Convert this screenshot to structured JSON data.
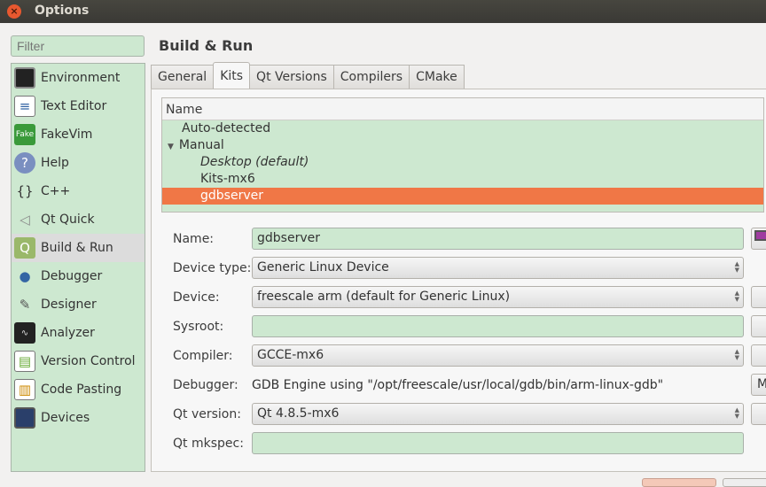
{
  "window": {
    "title": "Options",
    "close_icon": "close-icon"
  },
  "filter": {
    "placeholder": "Filter"
  },
  "sidebar": {
    "items": [
      {
        "label": "Environment",
        "icon": "monitor-icon"
      },
      {
        "label": "Text Editor",
        "icon": "text-editor-icon"
      },
      {
        "label": "FakeVim",
        "icon": "fakevim-icon"
      },
      {
        "label": "Help",
        "icon": "help-icon"
      },
      {
        "label": "C++",
        "icon": "braces-icon"
      },
      {
        "label": "Qt Quick",
        "icon": "qt-quick-icon"
      },
      {
        "label": "Build & Run",
        "icon": "build-run-icon",
        "selected": true
      },
      {
        "label": "Debugger",
        "icon": "debugger-icon"
      },
      {
        "label": "Designer",
        "icon": "designer-icon"
      },
      {
        "label": "Analyzer",
        "icon": "analyzer-icon"
      },
      {
        "label": "Version Control",
        "icon": "version-control-icon"
      },
      {
        "label": "Code Pasting",
        "icon": "code-pasting-icon"
      },
      {
        "label": "Devices",
        "icon": "devices-icon"
      }
    ]
  },
  "page": {
    "title": "Build & Run"
  },
  "tabs": [
    {
      "label": "General"
    },
    {
      "label": "Kits",
      "active": true
    },
    {
      "label": "Qt Versions"
    },
    {
      "label": "Compilers"
    },
    {
      "label": "CMake"
    }
  ],
  "tree": {
    "header": "Name",
    "rows": [
      {
        "label": "Auto-detected"
      },
      {
        "label": "Manual",
        "expanded": true
      },
      {
        "label": "Desktop (default)"
      },
      {
        "label": "Kits-mx6"
      },
      {
        "label": "gdbserver",
        "selected": true
      }
    ]
  },
  "form": {
    "name": {
      "label": "Name:",
      "value": "gdbserver"
    },
    "device_type": {
      "label": "Device type:",
      "value": "Generic Linux Device"
    },
    "device": {
      "label": "Device:",
      "value": "freescale arm (default for Generic Linux)"
    },
    "sysroot": {
      "label": "Sysroot:",
      "value": ""
    },
    "compiler": {
      "label": "Compiler:",
      "value": "GCCE-mx6"
    },
    "debugger": {
      "label": "Debugger:",
      "value": "GDB Engine using \"/opt/freescale/usr/local/gdb/bin/arm-linux-gdb\"",
      "button": "M"
    },
    "qt_version": {
      "label": "Qt version:",
      "value": "Qt 4.8.5-mx6"
    },
    "qt_mkspec": {
      "label": "Qt mkspec:",
      "value": ""
    }
  },
  "colors": {
    "accent": "#f07746",
    "field_bg": "#cde8d0",
    "titlebar": "#3c3b37"
  }
}
